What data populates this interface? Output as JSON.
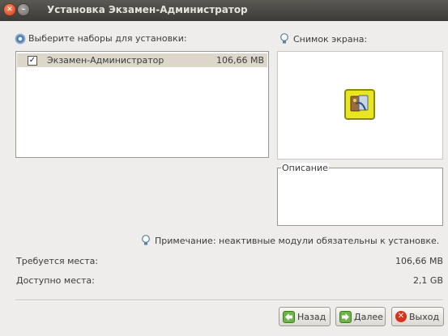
{
  "window": {
    "title": "Установка Экзамен-Администратор"
  },
  "left": {
    "heading": "Выберите наборы для установки:",
    "items": [
      {
        "name": "Экзамен-Администратор",
        "size": "106,66 MB",
        "checked": true
      }
    ]
  },
  "right": {
    "screenshot_heading": "Снимок экрана:",
    "description_legend": "Описание"
  },
  "note": "Примечание: неактивные модули обязательны к установке.",
  "space": {
    "required_label": "Требуется места:",
    "required_value": "106,66 MB",
    "available_label": "Доступно места:",
    "available_value": "2,1 GB"
  },
  "buttons": {
    "back": "Назад",
    "next": "Далее",
    "exit": "Выход"
  }
}
